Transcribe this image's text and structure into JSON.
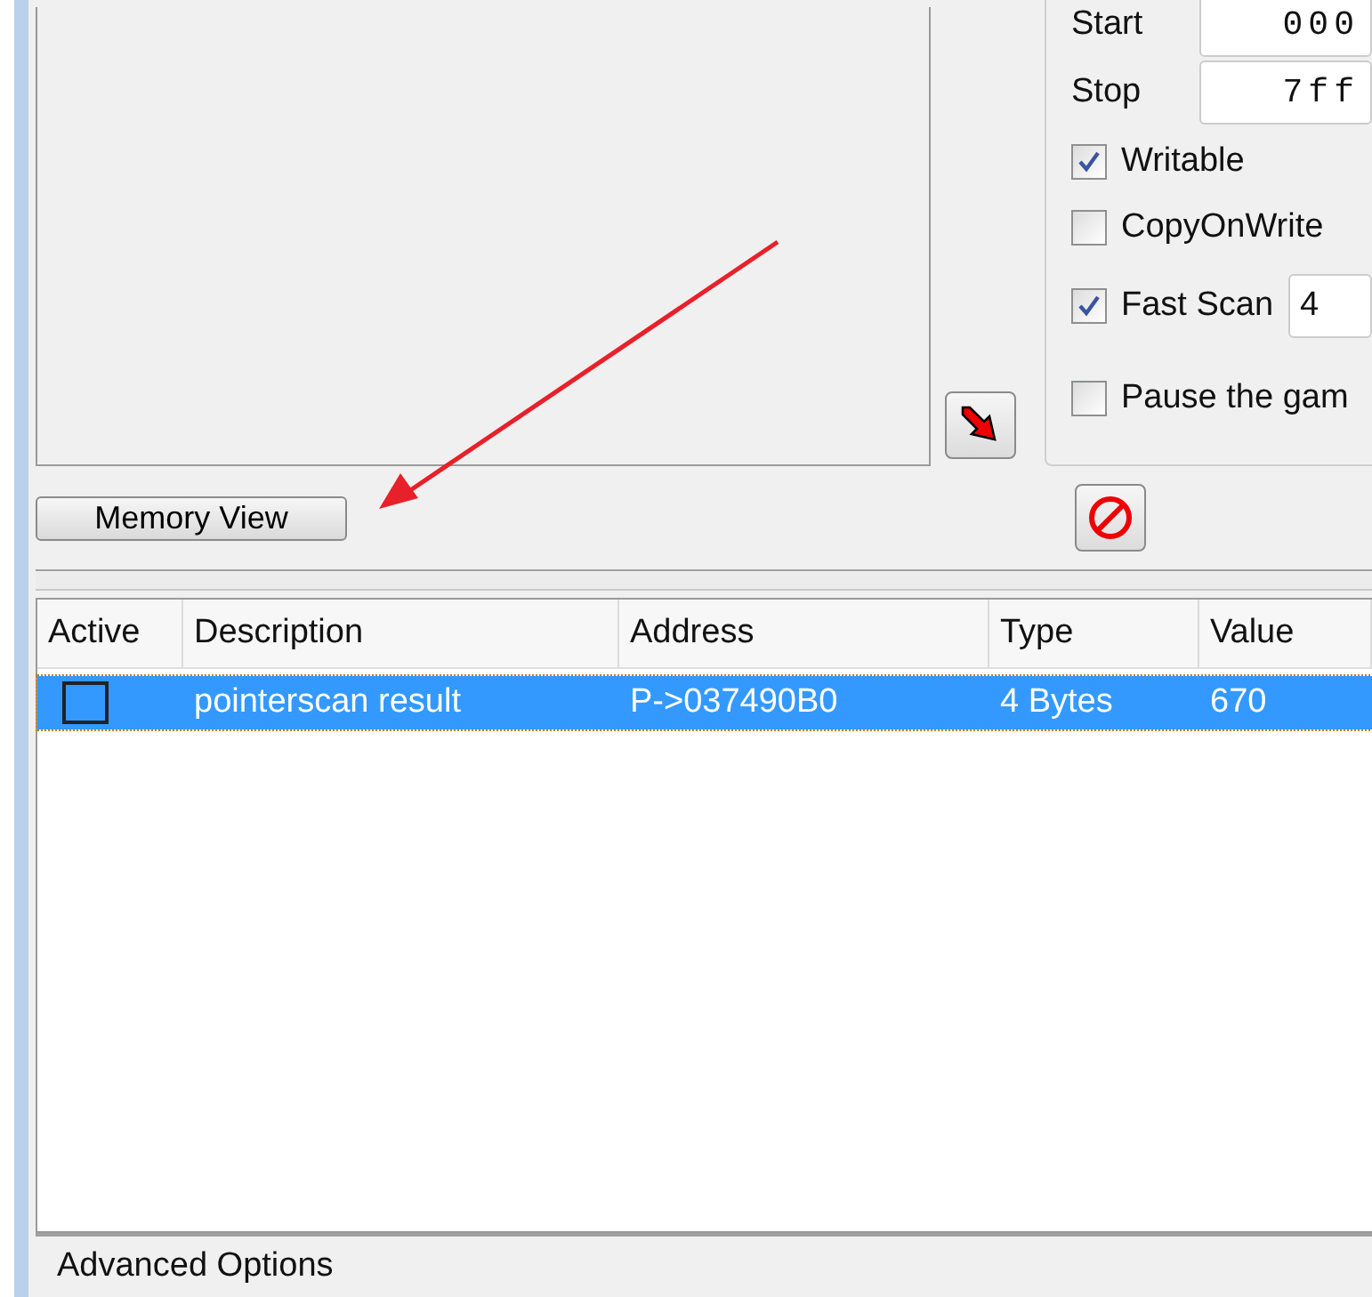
{
  "scan_range": {
    "start_label": "Start",
    "start_value": "000",
    "stop_label": "Stop",
    "stop_value": "7ff"
  },
  "scan_options": [
    {
      "kind": "checkbox",
      "label": "Writable",
      "checked": true
    },
    {
      "kind": "checkbox",
      "label": "CopyOnWrite",
      "checked": false
    },
    {
      "kind": "checkbox_field",
      "label": "Fast Scan",
      "checked": true,
      "value": "4"
    },
    {
      "kind": "checkbox",
      "label": "Pause the gam",
      "checked": false
    }
  ],
  "memory_view_button": "Memory View",
  "address_table": {
    "columns": [
      "Active",
      "Description",
      "Address",
      "Type",
      "Value"
    ],
    "rows": [
      {
        "active": false,
        "selected": true,
        "description": "pointerscan result",
        "address": "P->037490B0",
        "type": "4 Bytes",
        "value": "670"
      }
    ]
  },
  "footer": "Advanced Options"
}
